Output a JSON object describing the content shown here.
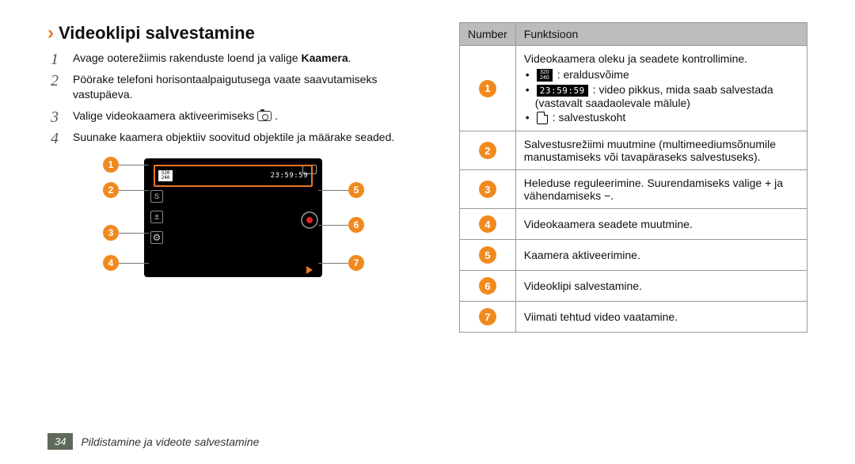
{
  "section_title": "Videoklipi salvestamine",
  "steps": [
    {
      "num": "1",
      "text_pre": "Avage ooterežiimis rakenduste loend ja valige ",
      "text_bold": "Kaamera",
      "text_post": "."
    },
    {
      "num": "2",
      "text": "Pöörake telefoni horisontaalpaigutusega vaate saavutamiseks vastupäeva."
    },
    {
      "num": "3",
      "text_pre": "Valige videokaamera aktiveerimiseks ",
      "has_cam_icon": true,
      "text_post": " ."
    },
    {
      "num": "4",
      "text": "Suunake kaamera objektiiv soovitud objektile ja määrake seaded."
    }
  ],
  "viewfinder": {
    "resolution_top": "320",
    "resolution_bottom": "240",
    "time": "23:59:59"
  },
  "callouts_left": [
    "1",
    "2",
    "3",
    "4"
  ],
  "callouts_right": [
    "5",
    "6",
    "7"
  ],
  "table": {
    "head_number": "Number",
    "head_function": "Funktsioon",
    "rows": [
      {
        "num": "1",
        "lead": "Videokaamera oleku ja seadete kontrollimine.",
        "bullets": [
          {
            "icon": "res",
            "text": ": eraldusvõime"
          },
          {
            "icon": "time",
            "text": ": video pikkus, mida saab salvestada (vastavalt saadaolevale mälule)"
          },
          {
            "icon": "sd",
            "text": ": salvestuskoht"
          }
        ]
      },
      {
        "num": "2",
        "text": "Salvestusrežiimi muutmine (multimeediumsõnumile manustamiseks või tavapäraseks salvestuseks)."
      },
      {
        "num": "3",
        "text": "Heleduse reguleerimine. Suurendamiseks valige + ja vähendamiseks −."
      },
      {
        "num": "4",
        "text": "Videokaamera seadete muutmine."
      },
      {
        "num": "5",
        "text": "Kaamera aktiveerimine."
      },
      {
        "num": "6",
        "text": "Videoklipi salvestamine."
      },
      {
        "num": "7",
        "text": "Viimati tehtud video vaatamine."
      }
    ]
  },
  "footer": {
    "page": "34",
    "chapter": "Pildistamine ja videote salvestamine"
  }
}
